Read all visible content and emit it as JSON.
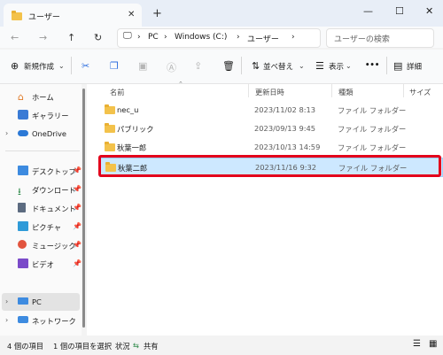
{
  "tab": {
    "title": "ユーザー",
    "close": "✕",
    "new_tab": "+"
  },
  "window_controls": {
    "minimize": "—",
    "maximize": "☐",
    "close": "✕"
  },
  "nav": {
    "back": "←",
    "forward": "→",
    "up": "↑",
    "refresh": "↻"
  },
  "address": {
    "monitor_icon": "🖵",
    "sep": "›",
    "crumbs": [
      "PC",
      "Windows (C:)",
      "ユーザー"
    ]
  },
  "search": {
    "placeholder": "ユーザーの検索"
  },
  "toolbar": {
    "new_label": "新規作成",
    "sort_label": "並べ替え",
    "view_label": "表示",
    "more": "•••",
    "details_label": "詳細"
  },
  "sidebar": {
    "home": "ホーム",
    "gallery": "ギャラリー",
    "onedrive": "OneDrive",
    "desktop": "デスクトップ",
    "downloads": "ダウンロード",
    "documents": "ドキュメント",
    "pictures": "ピクチャ",
    "music": "ミュージック",
    "videos": "ビデオ",
    "pc": "PC",
    "network": "ネットワーク"
  },
  "columns": {
    "name": "名前",
    "date": "更新日時",
    "type": "種類",
    "size": "サイズ"
  },
  "files": [
    {
      "name": "nec_u",
      "date": "2023/11/02 8:13",
      "type": "ファイル フォルダー"
    },
    {
      "name": "パブリック",
      "date": "2023/09/13 9:45",
      "type": "ファイル フォルダー"
    },
    {
      "name": "秋葉一郎",
      "date": "2023/10/13 14:59",
      "type": "ファイル フォルダー"
    },
    {
      "name": "秋葉二郎",
      "date": "2023/11/16 9:32",
      "type": "ファイル フォルダー"
    }
  ],
  "status": {
    "count": "4 個の項目",
    "selected": "1 個の項目を選択",
    "state_label": "状況",
    "share": "共有"
  },
  "colors": {
    "selection": "#cde8ff",
    "highlight_box": "#e3001b",
    "folder": "#f3c24b"
  }
}
